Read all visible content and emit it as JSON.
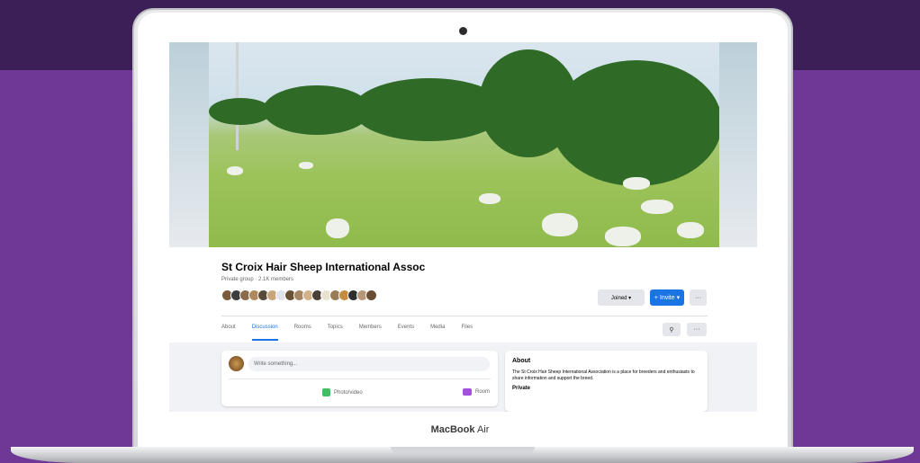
{
  "device": {
    "brand_bold": "MacBook",
    "brand_light": " Air"
  },
  "group": {
    "name": "St Croix Hair Sheep International Assoc",
    "meta": "Private group · 2.1K members",
    "joined_label": "Joined ▾",
    "invite_label": "+ Invite ▾",
    "more_label": "···"
  },
  "tabs": [
    "About",
    "Discussion",
    "Rooms",
    "Topics",
    "Members",
    "Events",
    "Media",
    "Files"
  ],
  "composer": {
    "placeholder": "Write something...",
    "photo_label": "Photo/video",
    "video_label": "Room"
  },
  "about": {
    "heading": "About",
    "text": "The St Croix Hair Sheep International Association is a place for breeders and enthusiasts to share information and support the breed.",
    "visibility": "Private"
  },
  "icons": {
    "search": "search-icon",
    "more": "more-icon",
    "photo": "photo-icon",
    "video": "video-icon"
  },
  "colors": {
    "accent": "#1b74e4",
    "background": "#6f3796",
    "band": "#3d1f57"
  }
}
